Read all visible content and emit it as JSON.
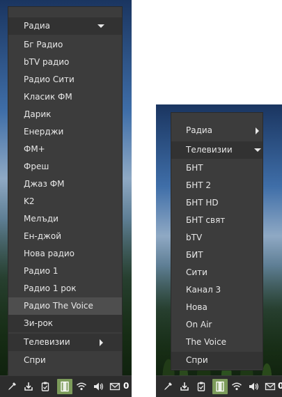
{
  "left_menu": {
    "radio_header": "Радиа",
    "radio_items": [
      "Бг Радио",
      "bTV радио",
      "Радио Сити",
      "Класик ФМ",
      "Дарик",
      "Енерджи",
      "ФМ+",
      "Фреш",
      "Джаз ФМ",
      "K2",
      "Мелъди",
      "Ен-джой",
      "Нова радио",
      "Радио 1",
      "Радио 1 рок",
      "Радио The Voice",
      "Зи-рок"
    ],
    "active_item": "Радио The Voice",
    "tv_label": "Телевизии",
    "stop_label": "Спри"
  },
  "right_menu": {
    "radio_label": "Радиа",
    "tv_header": "Телевизии",
    "tv_items": [
      "БНТ",
      "БНТ 2",
      "БНТ HD",
      "БНТ свят",
      "bTV",
      "БИТ",
      "Сити",
      "Канал 3",
      "Нова",
      "On Air",
      "The Voice"
    ],
    "stop_label": "Спри"
  },
  "panel": {
    "icons": [
      "eyedropper-icon",
      "download-icon",
      "clipboard-icon",
      "film-strip-icon",
      "wifi-icon",
      "volume-icon",
      "mail-icon"
    ],
    "active_icon": "film-strip-icon",
    "mail_count": "0"
  },
  "colors": {
    "menu_bg": "#3c3c3c",
    "menu_text": "#e8e8e8",
    "active_bg": "#4e4e4e",
    "tray_active": "#7c9b5a"
  }
}
